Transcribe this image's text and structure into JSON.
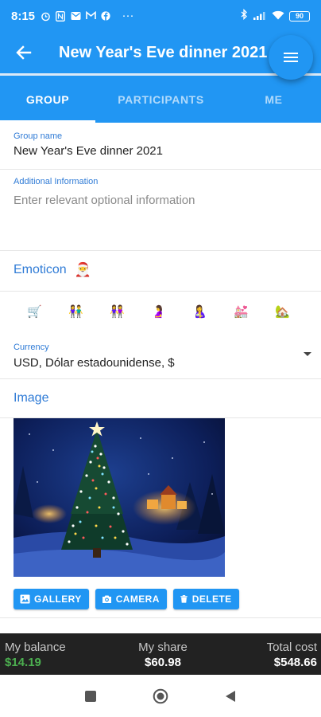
{
  "status_bar": {
    "time": "8:15",
    "battery": "90",
    "dots": "···",
    "left_icons": [
      "alarm-icon",
      "n-app-icon",
      "mail-icon",
      "gmail-icon",
      "facebook-icon"
    ],
    "right_icons": [
      "bluetooth-icon",
      "signal-icon",
      "wifi-icon",
      "battery-icon"
    ]
  },
  "app_bar": {
    "title": "New Year's Eve dinner 2021"
  },
  "tabs": [
    {
      "label": "GROUP",
      "active": true
    },
    {
      "label": "PARTICIPANTS",
      "active": false
    },
    {
      "label": "ME",
      "active": false
    }
  ],
  "form": {
    "group_name_label": "Group name",
    "group_name_value": "New Year's Eve dinner 2021",
    "additional_label": "Additional Information",
    "additional_placeholder": "Enter relevant optional information",
    "emoticon_label": "Emoticon",
    "emoticon_current": "🎅",
    "emoji_options": [
      "🛒",
      "👫",
      "👭",
      "🤰",
      "🤱",
      "💒",
      "🏡"
    ],
    "currency_label": "Currency",
    "currency_value": "USD, Dólar estadounidense, $",
    "image_label": "Image"
  },
  "image_buttons": [
    {
      "label": "GALLERY",
      "icon": "gallery-icon"
    },
    {
      "label": "CAMERA",
      "icon": "camera-icon"
    },
    {
      "label": "DELETE",
      "icon": "trash-icon"
    }
  ],
  "summary": {
    "balance_label": "My balance",
    "balance_value": "$14.19",
    "share_label": "My share",
    "share_value": "$60.98",
    "total_label": "Total cost",
    "total_value": "$548.66"
  },
  "colors": {
    "primary": "#2196f3",
    "accent_text": "#2f7bd6",
    "positive": "#4caf50",
    "summary_bg": "#222222"
  }
}
